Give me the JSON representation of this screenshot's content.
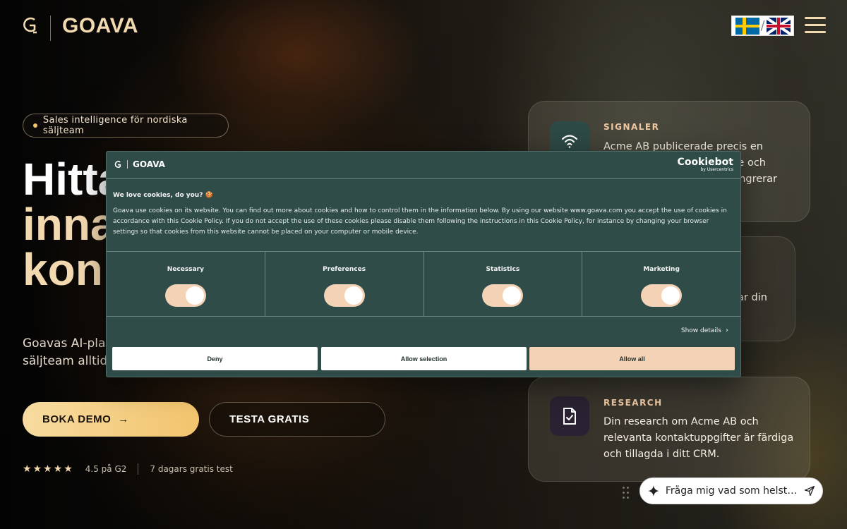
{
  "header": {
    "logo_mark": "G",
    "logo_text": "GOAVA",
    "lang_sv": "Svenska",
    "lang_en": "English",
    "lang_separator": "/"
  },
  "hero": {
    "badge": "Sales intelligence för nordiska säljteam",
    "title_line1": "Hitta",
    "title_line2": "inna",
    "title_line3": "konk",
    "description_line1": "Goavas AI-plattfo",
    "description_line2": "säljteam alltid p",
    "cta_demo": "BOKA DEMO",
    "cta_demo_arrow": "→",
    "cta_test": "TESTA GRATIS",
    "stars": "★★★★★",
    "rating": 4.5,
    "rating_text": "4.5 på G2",
    "trial_text": "7 dagars gratis test"
  },
  "cards": {
    "signals": {
      "label": "SIGNALER",
      "text_line1": "Acme AB publicerade precis en",
      "text_line2": "e och",
      "text_line3": "ngrerar"
    },
    "middle": {
      "text": "ar din"
    },
    "research": {
      "label": "RESEARCH",
      "text": "Din research om Acme AB och relevanta kontaktuppgifter är färdiga och tillagda i ditt CRM."
    }
  },
  "cookie": {
    "logo_text": "GOAVA",
    "brand": "Cookiebot",
    "brand_sub": "by Usercentrics",
    "title": "We love cookies, do you? 🍪",
    "body": "Goava use cookies on its website. You can find out more about cookies and how to control them in the information below. By using our website www.goava.com you accept the use of cookies in accordance with this Cookie Policy. If you do not accept the use of these cookies please disable them following the instructions in this Cookie Policy, for instance by changing your browser settings so that cookies from this website cannot be placed on your computer or mobile device.",
    "categories": [
      {
        "label": "Necessary",
        "enabled": true
      },
      {
        "label": "Preferences",
        "enabled": true
      },
      {
        "label": "Statistics",
        "enabled": true
      },
      {
        "label": "Marketing",
        "enabled": true
      }
    ],
    "show_details": "Show details",
    "btn_deny": "Deny",
    "btn_selection": "Allow selection",
    "btn_all": "Allow all"
  },
  "chat": {
    "placeholder": "Fråga mig vad som helst ..."
  },
  "colors": {
    "accent": "#f3d9b0",
    "cta": "#f2c46d",
    "cookie_bg": "#2f4c48",
    "cookie_accent": "#f3d2b6"
  }
}
